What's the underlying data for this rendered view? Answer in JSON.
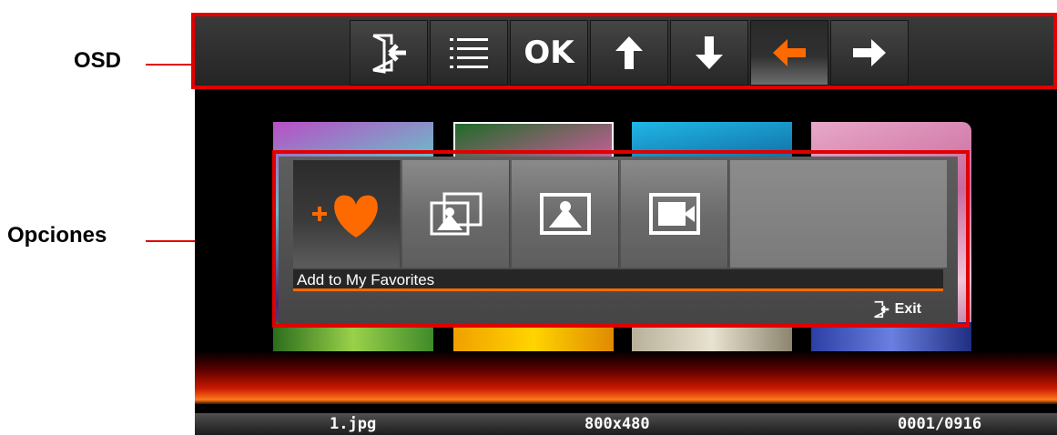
{
  "annotations": {
    "osd_label": "OSD",
    "options_label": "Opciones"
  },
  "osd": {
    "buttons": [
      {
        "icon": "exit-door-icon",
        "text": ""
      },
      {
        "icon": "list-menu-icon",
        "text": ""
      },
      {
        "icon": "ok-icon",
        "text": "OK"
      },
      {
        "icon": "arrow-up-icon",
        "text": ""
      },
      {
        "icon": "arrow-down-icon",
        "text": ""
      },
      {
        "icon": "arrow-left-icon",
        "text": "",
        "active": true
      },
      {
        "icon": "arrow-right-icon",
        "text": ""
      }
    ]
  },
  "options": {
    "items": [
      {
        "icon": "add-favorite-heart-icon",
        "active": true
      },
      {
        "icon": "slideshow-icon"
      },
      {
        "icon": "picture-icon"
      },
      {
        "icon": "picture-next-icon"
      }
    ],
    "selected_label": "Add to My Favorites",
    "exit_label": "Exit"
  },
  "status": {
    "filename": "1.jpg",
    "resolution": "800x480",
    "counter": "0001/0916"
  },
  "colors": {
    "highlight": "#e00000",
    "accent": "#ff6a00"
  }
}
